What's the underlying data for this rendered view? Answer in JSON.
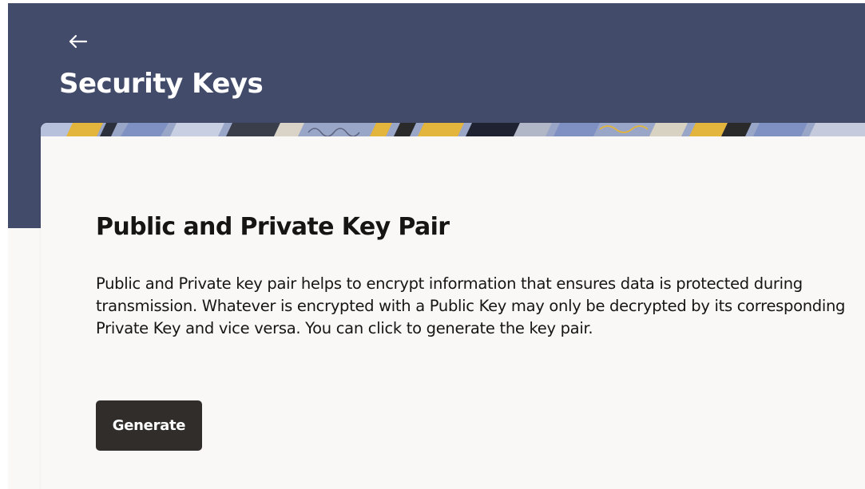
{
  "header": {
    "back_icon": "arrow-left-icon",
    "title": "Security Keys"
  },
  "card": {
    "title": "Public and Private Key Pair",
    "description": "Public and Private key pair helps to encrypt information that ensures data is protected during transmission. Whatever is encrypted with a Public Key may only be decrypted by its corresponding Private Key and vice versa. You can click to generate the key pair.",
    "generate_label": "Generate"
  },
  "colors": {
    "header_background": "#434b6a",
    "page_background": "#faf8f7",
    "button_background": "#312d2a",
    "text_primary": "#161513",
    "banner_yellow": "#e3b53c",
    "banner_blue": "#7f91c2",
    "banner_dark": "#2a2a2a"
  }
}
